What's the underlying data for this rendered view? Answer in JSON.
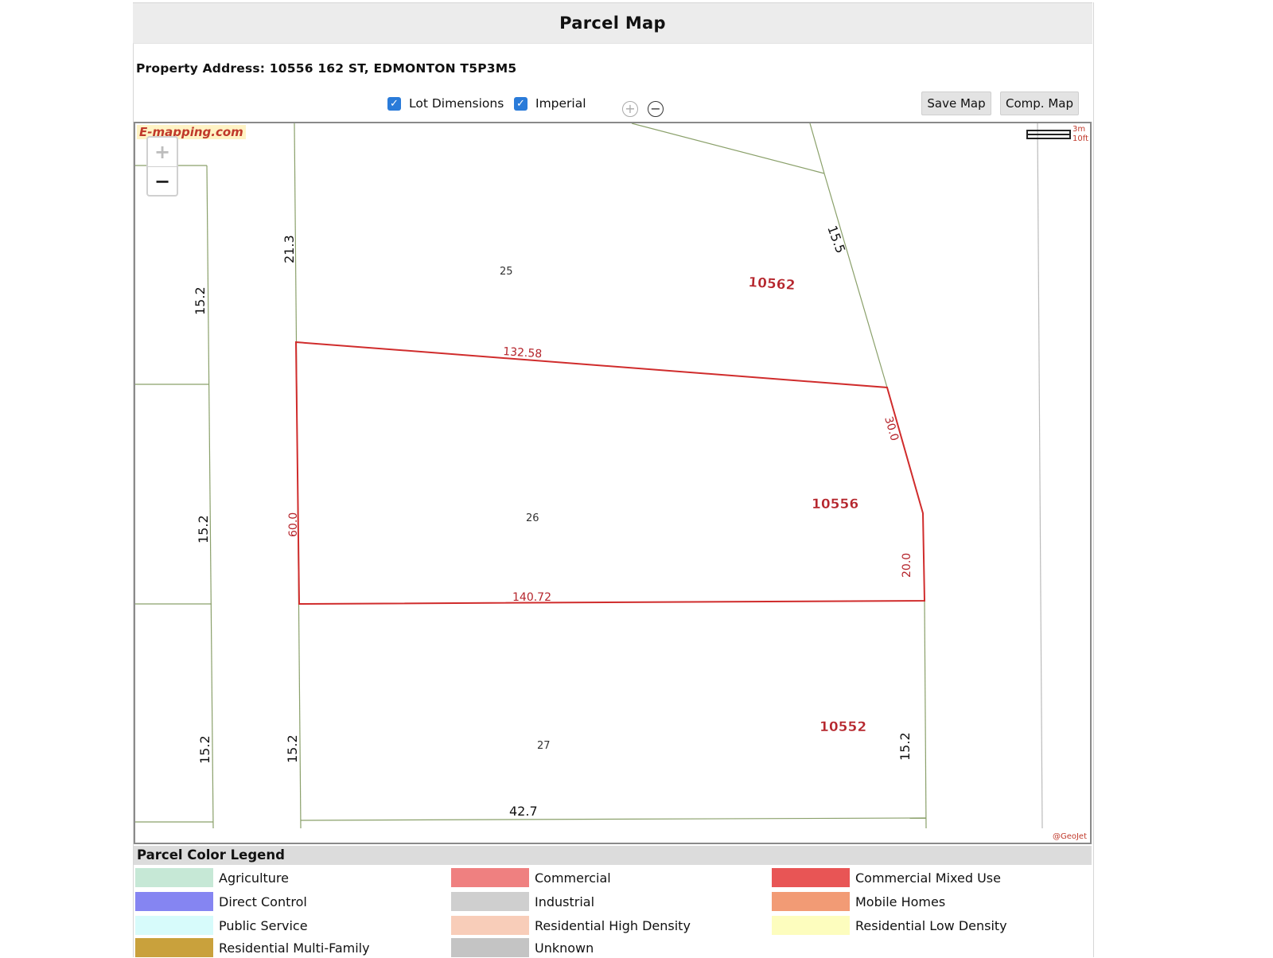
{
  "title": "Parcel Map",
  "address": "Property Address: 10556 162 ST, EDMONTON T5P3M5",
  "toolbar": {
    "lot_dimensions": {
      "label": "Lot Dimensions",
      "checked": true
    },
    "imperial": {
      "label": "Imperial",
      "checked": true
    },
    "zoom_in": "+",
    "zoom_out": "−",
    "save_map": "Save Map",
    "comp_map": "Comp. Map"
  },
  "map": {
    "brand": "E-mapping.com",
    "zoom_in": "+",
    "zoom_out": "−",
    "scale": {
      "metric": "3m",
      "imperial": "10ft"
    },
    "credit": "@GeoJet",
    "parcel_numbers": {
      "top": "10562",
      "subject": "10556",
      "bottom": "10552"
    },
    "lot_numbers": {
      "top": "25",
      "subject": "26",
      "bottom": "27"
    },
    "dimensions": {
      "top_left_side": "21.3",
      "top_right_side": "15.5",
      "subject_top": "132.58",
      "subject_right_upper": "30.0",
      "subject_left": "60.0",
      "subject_right_lower": "20.0",
      "subject_bottom": "140.72",
      "bottom_left": "15.2",
      "bottom_right": "15.2",
      "bottom_edge": "42.7",
      "west_1": "15.2",
      "west_2": "15.2",
      "west_3": "15.2"
    },
    "colors": {
      "parcel_line": "#8aa06a",
      "subject_line": "#d02c2c",
      "label_red": "#b5252c"
    }
  },
  "legend": {
    "title": "Parcel Color Legend",
    "items": [
      {
        "label": "Agriculture",
        "color": "#c6e8d6"
      },
      {
        "label": "Commercial",
        "color": "#ef8080"
      },
      {
        "label": "Commercial Mixed Use",
        "color": "#e85555"
      },
      {
        "label": "Direct Control",
        "color": "#8585f2"
      },
      {
        "label": "Industrial",
        "color": "#cfcfcf"
      },
      {
        "label": "Mobile Homes",
        "color": "#f29b75"
      },
      {
        "label": "Public Service",
        "color": "#d7fbfb"
      },
      {
        "label": "Residential High Density",
        "color": "#f8cdb9"
      },
      {
        "label": "Residential Low Density",
        "color": "#fdfdbe"
      },
      {
        "label": "Residential Multi-Family",
        "color": "#c9a13c"
      },
      {
        "label": "Unknown",
        "color": "#c4c4c4"
      }
    ]
  }
}
